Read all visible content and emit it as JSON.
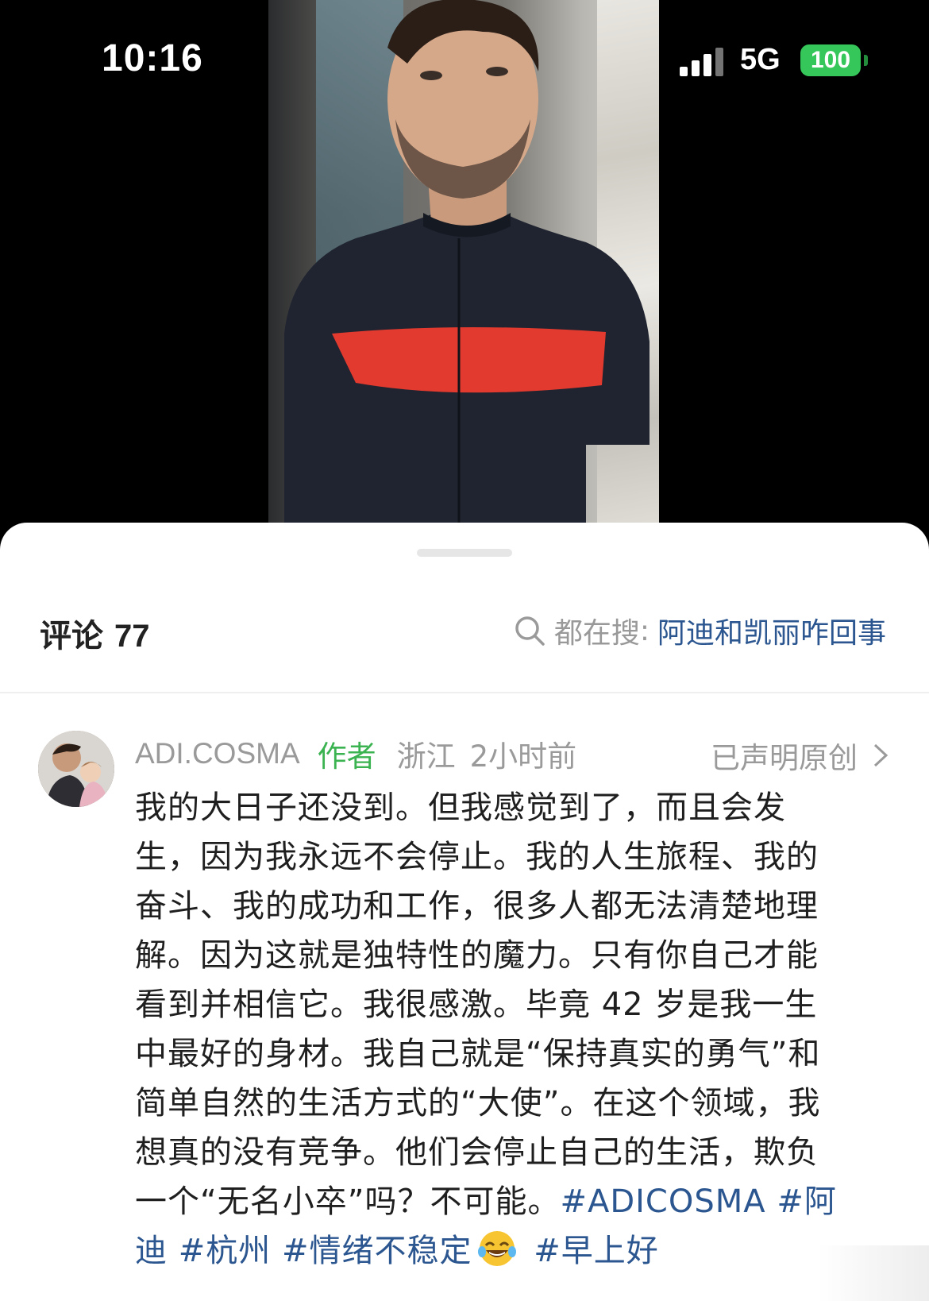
{
  "status_bar": {
    "time": "10:16",
    "network": "5G",
    "battery": "100"
  },
  "colors": {
    "author_green": "#3bb351",
    "link_blue": "#2b5690",
    "battery_green": "#35c759"
  },
  "comments": {
    "title": "评论",
    "count": "77",
    "search_prefix": "都在搜",
    "search_term": "阿迪和凯丽咋回事"
  },
  "comment": {
    "username": "ADI.COSMA",
    "author_tag": "作者",
    "location": "浙江",
    "time_ago": "2小时前",
    "original_claim": "已声明原创",
    "lines": [
      "我的大日子还没到。但我感觉到了，而且会发",
      "生，因为我永远不会停止。我的人生旅程、我的",
      "奋斗、我的成功和工作，很多人都无法清楚地理",
      "解。因为这就是独特性的魔力。只有你自己才能",
      "看到并相信它。我很感激。毕竟 42 岁是我一生",
      "中最好的身材。我自己就是“保持真实的勇气”和",
      "简单自然的生活方式的“大使”。在这个领域，我",
      "想真的没有竞争。他们会停止自己的生活，欺负"
    ],
    "line9_text": "一个“无名小卒”吗？不可能。",
    "line9_tag1": "#ADICOSMA",
    "line9_tag2": "#阿",
    "line10_tag2_cont": "迪",
    "line10_tag3": "#杭州",
    "line10_tag4": "#情绪不稳定",
    "line10_tag5": "#早上好"
  },
  "icons": {
    "search": "search-icon",
    "chevron": "chevron-right-icon",
    "emoji": "laugh-cry-emoji-icon"
  }
}
